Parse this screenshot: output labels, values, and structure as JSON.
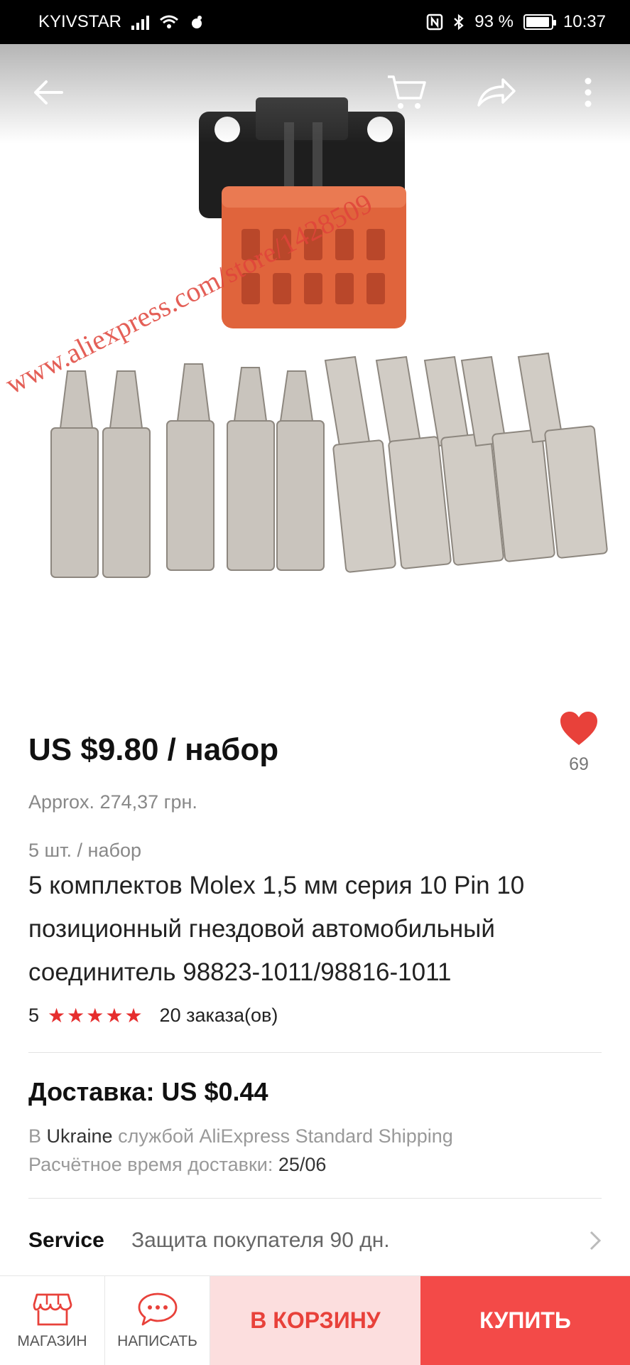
{
  "status": {
    "carrier": "KYIVSTAR",
    "battery": "93 %",
    "time": "10:37"
  },
  "product": {
    "watermark": "www.aliexpress.com/store/1428509",
    "price": "US $9.80 / набор",
    "approx": "Approx. 274,37 грн.",
    "unit": "5 шт. / набор",
    "wishlist_count": "69",
    "title": "5 комплектов Molex 1,5 мм серия 10 Pin 10 позиционный гнездовой автомобильный соединитель 98823-1011/98816-1011",
    "rating": "5",
    "stars": "★★★★★",
    "orders": "20 заказа(ов)"
  },
  "shipping": {
    "title": "Доставка: US $0.44",
    "prefix": "В ",
    "country": "Ukraine",
    "method": " службой AliExpress Standard Shipping",
    "eta_label": "Расчётное время доставки: ",
    "eta": "25/06"
  },
  "service": {
    "label": "Service",
    "text": "Защита покупателя 90 дн."
  },
  "bottom": {
    "store_label": "МАГАЗИН",
    "message_label": "НАПИСАТЬ",
    "cart_label": "В КОРЗИНУ",
    "buy_label": "КУПИТЬ"
  },
  "colors": {
    "accent": "#f34a48",
    "cart_bg": "#fcdede",
    "heart": "#e8413a",
    "stars": "#e62e2e"
  }
}
